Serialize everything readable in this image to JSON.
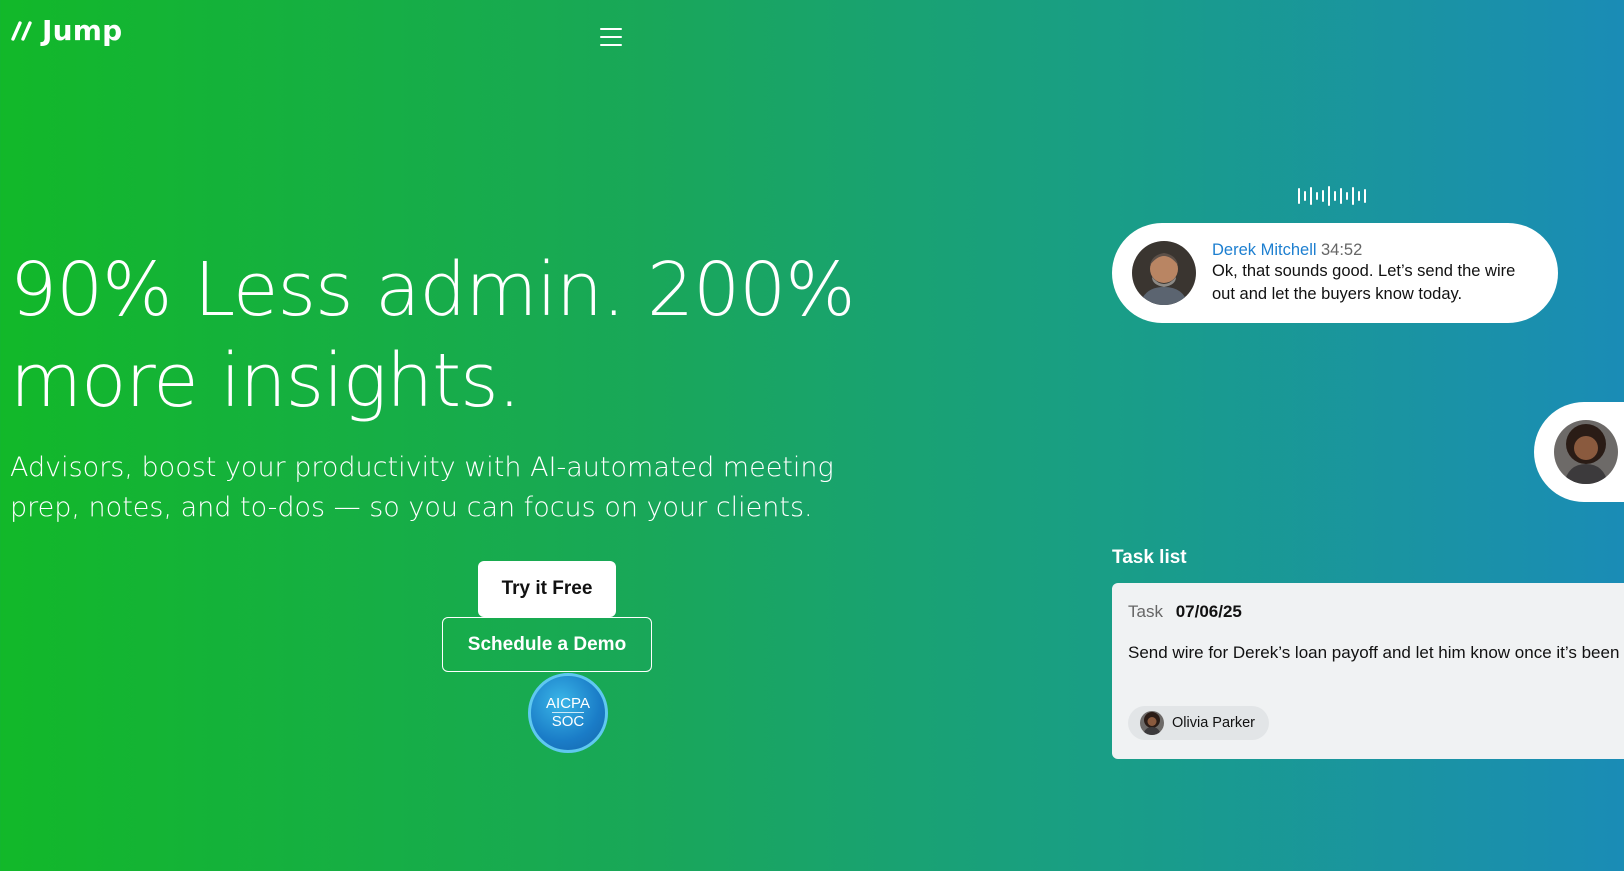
{
  "brand": {
    "name": "Jump"
  },
  "nav": {
    "menu_icon": "hamburger-menu-icon"
  },
  "hero": {
    "title": "90% Less admin. 200% more insights.",
    "subtitle": "Advisors, boost your productivity with AI-automated meeting prep, notes, and to-dos — so you can focus on your clients.",
    "cta_primary": "Try it Free",
    "cta_secondary": "Schedule a Demo",
    "badge": {
      "top": "AICPA",
      "bottom": "SOC"
    }
  },
  "transcript": {
    "speaker": "Derek Mitchell",
    "timestamp": "34:52",
    "message": "Ok, that sounds good. Let’s send the wire out and let the buyers know today."
  },
  "task_list": {
    "heading": "Task list",
    "task_label": "Task",
    "date": "07/06/25",
    "description": "Send wire for Derek’s loan payoff and let him know once it’s been sent.",
    "assignee": "Olivia Parker"
  },
  "colors": {
    "gradient_start": "#12b829",
    "gradient_end": "#1a8cb6",
    "speaker_name": "#1d7fd0"
  }
}
